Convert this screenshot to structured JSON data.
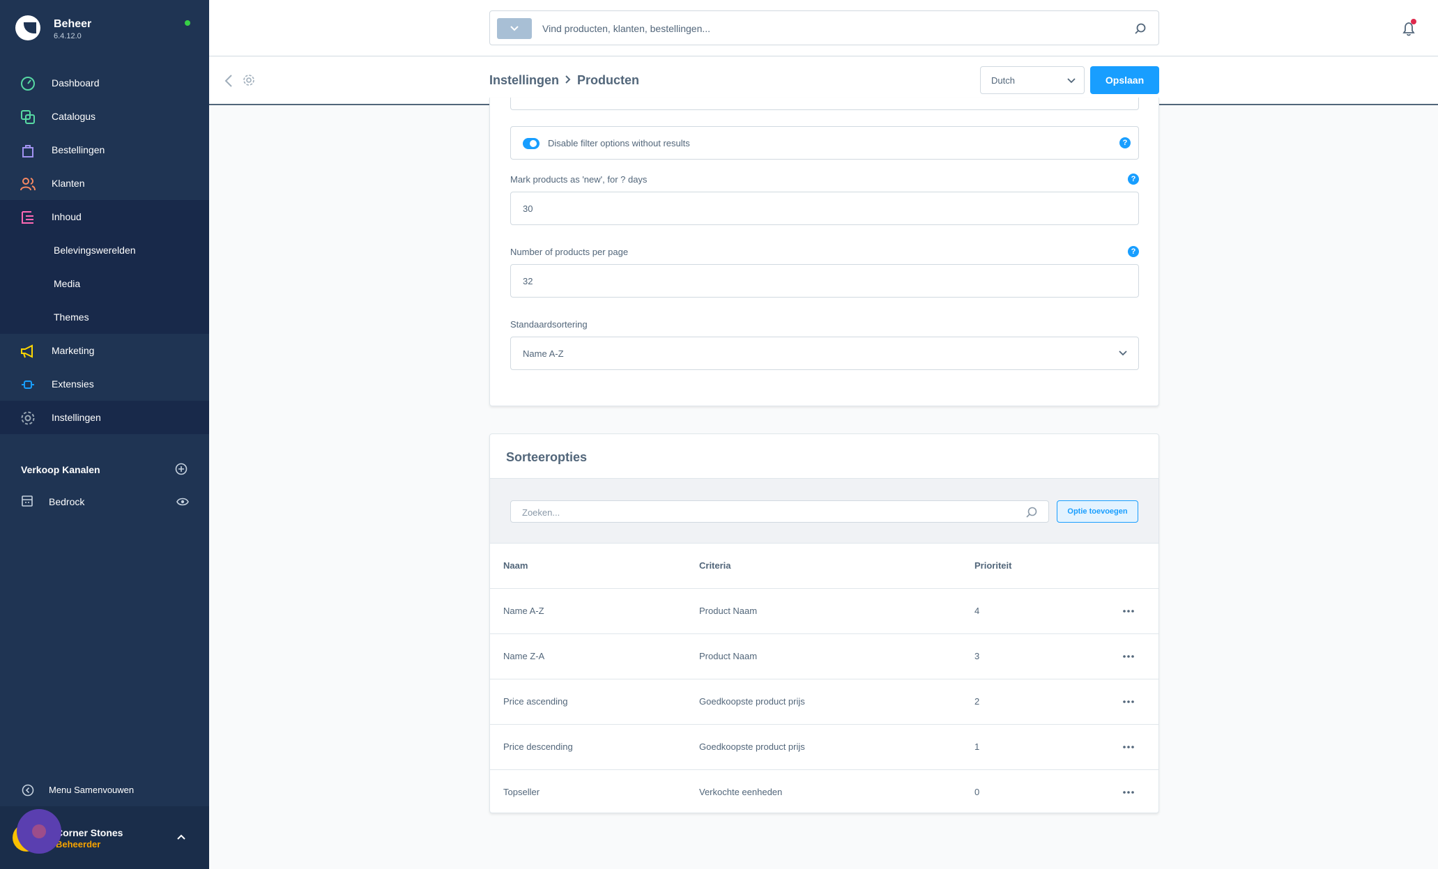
{
  "app": {
    "name": "Beheer",
    "version": "6.4.12.0"
  },
  "sidebar": {
    "items": [
      {
        "label": "Dashboard",
        "icon": "dashboard-icon",
        "color": "#57d9a3"
      },
      {
        "label": "Catalogus",
        "icon": "catalog-icon",
        "color": "#57d9a3"
      },
      {
        "label": "Bestellingen",
        "icon": "orders-icon",
        "color": "#a092f0"
      },
      {
        "label": "Klanten",
        "icon": "customers-icon",
        "color": "#f88962"
      },
      {
        "label": "Inhoud",
        "icon": "content-icon",
        "color": "#ff68b4"
      },
      {
        "label": "Belevingswerelden"
      },
      {
        "label": "Media"
      },
      {
        "label": "Themes"
      },
      {
        "label": "Marketing",
        "icon": "marketing-icon",
        "color": "#ffd700"
      },
      {
        "label": "Extensies",
        "icon": "extensions-icon",
        "color": "#189eff"
      },
      {
        "label": "Instellingen",
        "icon": "settings-icon",
        "color": "#9aa8b5"
      }
    ],
    "sales_channels_title": "Verkoop Kanalen",
    "sales_channel": "Bedrock",
    "collapse_label": "Menu Samenvouwen",
    "user": {
      "name": "Corner Stones",
      "role": "Beheerder"
    }
  },
  "search": {
    "placeholder": "Vind producten, klanten, bestellingen..."
  },
  "breadcrumb": {
    "parent": "Instellingen",
    "current": "Producten"
  },
  "language": "Dutch",
  "save_label": "Opslaan",
  "settings": {
    "toggle_label": "Disable filter options without results",
    "toggle_on": true,
    "new_days_label": "Mark products as 'new', for ? days",
    "new_days_value": "30",
    "per_page_label": "Number of products per page",
    "per_page_value": "32",
    "sorting_label": "Standaardsortering",
    "sorting_value": "Name A-Z",
    "help_glyph": "?"
  },
  "sort_options": {
    "title": "Sorteeropties",
    "search_placeholder": "Zoeken...",
    "add_label": "Optie toevoegen",
    "columns": [
      "Naam",
      "Criteria",
      "Prioriteit"
    ],
    "rows": [
      {
        "name": "Name A-Z",
        "criteria": "Product Naam",
        "priority": "4"
      },
      {
        "name": "Name Z-A",
        "criteria": "Product Naam",
        "priority": "3"
      },
      {
        "name": "Price ascending",
        "criteria": "Goedkoopste product prijs",
        "priority": "2"
      },
      {
        "name": "Price descending",
        "criteria": "Goedkoopste product prijs",
        "priority": "1"
      },
      {
        "name": "Topseller",
        "criteria": "Verkochte eenheden",
        "priority": "0"
      }
    ]
  },
  "colors": {
    "accent": "#189eff",
    "sidebar": "#1f3453",
    "status_online": "#37d046"
  }
}
